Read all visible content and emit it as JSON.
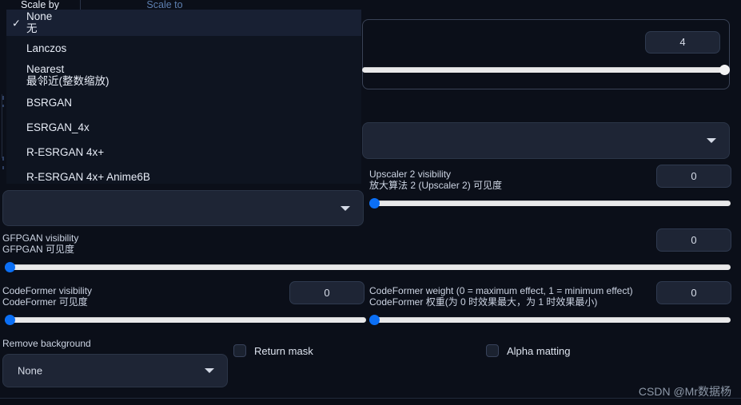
{
  "tabs": {
    "scale_by": "Scale by",
    "scale_to": "Scale to"
  },
  "upscaler_dropdown": {
    "open": true,
    "selected": "None",
    "check_glyph": "✓",
    "items": [
      {
        "en": "None",
        "cn": "无",
        "selected": true
      },
      {
        "en": "Lanczos",
        "cn": "",
        "selected": false
      },
      {
        "en": "Nearest",
        "cn": "最邻近(整数缩放)",
        "selected": false
      },
      {
        "en": "BSRGAN",
        "cn": "",
        "selected": false
      },
      {
        "en": "ESRGAN_4x",
        "cn": "",
        "selected": false
      },
      {
        "en": "R-ESRGAN 4x+",
        "cn": "",
        "selected": false
      },
      {
        "en": "R-ESRGAN 4x+ Anime6B",
        "cn": "",
        "selected": false
      }
    ]
  },
  "resize_panel": {
    "value": "4",
    "slider_percent": 100
  },
  "upscaler1": {
    "value": "",
    "caret": "chevron-down-icon"
  },
  "upscaler2_select": {
    "value": "",
    "caret": "chevron-down-icon"
  },
  "upscaler2_visibility": {
    "label_en": "Upscaler 2 visibility",
    "label_cn": "放大算法 2 (Upscaler 2) 可见度",
    "value": "0",
    "slider_percent": 0
  },
  "gfpgan_visibility": {
    "label_en": "GFPGAN visibility",
    "label_cn": "GFPGAN 可见度",
    "value": "0",
    "slider_percent": 0
  },
  "codeformer_visibility": {
    "label_en": "CodeFormer visibility",
    "label_cn": "CodeFormer 可见度",
    "value": "0",
    "slider_percent": 0
  },
  "codeformer_weight": {
    "label_en": "CodeFormer weight (0 = maximum effect, 1 = minimum effect)",
    "label_cn": "CodeFormer 权重(为 0 时效果最大，为 1 时效果最小)",
    "value": "0",
    "slider_percent": 0
  },
  "remove_background": {
    "label": "Remove background",
    "value": "None",
    "caret": "chevron-down-icon"
  },
  "return_mask": {
    "label": "Return mask",
    "checked": false
  },
  "alpha_matting": {
    "label": "Alpha matting",
    "checked": false
  },
  "watermark": "CSDN @Mr数据杨",
  "colors": {
    "background": "#0b0f19",
    "panel_border": "#3a4357",
    "accent_blue": "#0b6ff5",
    "slider_track": "#e9e9ea",
    "field_bg": "#1e2535",
    "menu_bg": "#0e1420",
    "menu_highlight": "#182033",
    "text": "#ccd4e3",
    "tab_active": "#e8edf7",
    "tab_inactive": "#5d7fb0"
  }
}
